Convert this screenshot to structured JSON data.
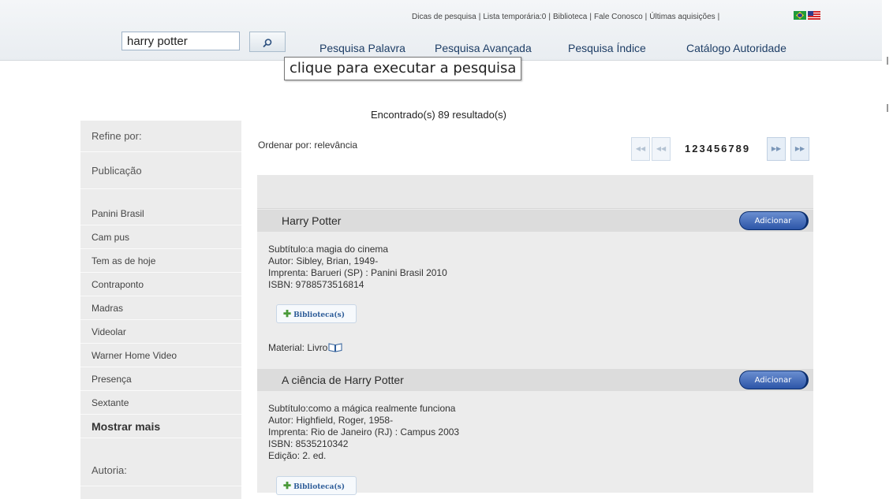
{
  "header": {
    "top_links": [
      "Dicas de pesquisa",
      "Lista temporária:0",
      "Biblioteca",
      "Fale Conosco",
      "Últimas aquisições"
    ],
    "search_value": "harry potter",
    "nav": [
      "Pesquisa Palavra",
      "Pesquisa Avançada",
      "Pesquisa Índice",
      "Catálogo Autoridade"
    ],
    "tooltip": "clique para executar a pesquisa"
  },
  "results": {
    "count_text": "Encontrado(s) 89 resultado(s)",
    "sort_label": "Ordenar por: relevância",
    "pages": [
      "1",
      "2",
      "3",
      "4",
      "5",
      "6",
      "7",
      "8",
      "9"
    ],
    "active_page": "1",
    "items": [
      {
        "title": "Harry Potter",
        "add_label": "Adicionar",
        "subtitle": "Subtítulo:a magia do cinema",
        "author": "Autor: Sibley, Brian, 1949-",
        "imprint": "Imprenta: Barueri (SP) : Panini Brasil 2010",
        "isbn": "ISBN: 9788573516814",
        "library_label": "Biblioteca(s)",
        "material": "Material: Livro"
      },
      {
        "title": "A ciência de Harry Potter",
        "add_label": "Adicionar",
        "subtitle": "Subtítulo:como a mágica realmente funciona",
        "author": "Autor: Highfield, Roger, 1958-",
        "imprint": "Imprenta: Rio de Janeiro (RJ) : Campus 2003",
        "isbn": "ISBN: 8535210342",
        "edition": "Edição: 2. ed.",
        "library_label": "Biblioteca(s)"
      }
    ]
  },
  "sidebar": {
    "refine_label": "Refine por:",
    "publication_label": "Publicação",
    "publishers": [
      "Panini Brasil",
      "Cam pus",
      "Tem as de hoje",
      "Contraponto",
      "Madras",
      "Videolar",
      "Warner Home Video",
      "Presença",
      "Sextante"
    ],
    "show_more": "Mostrar mais",
    "authorship_label": "Autoria:"
  },
  "colors": {
    "accent_button": "#2c55a7",
    "nav_link": "#1e3e66",
    "panel_bg": "#ececec"
  }
}
